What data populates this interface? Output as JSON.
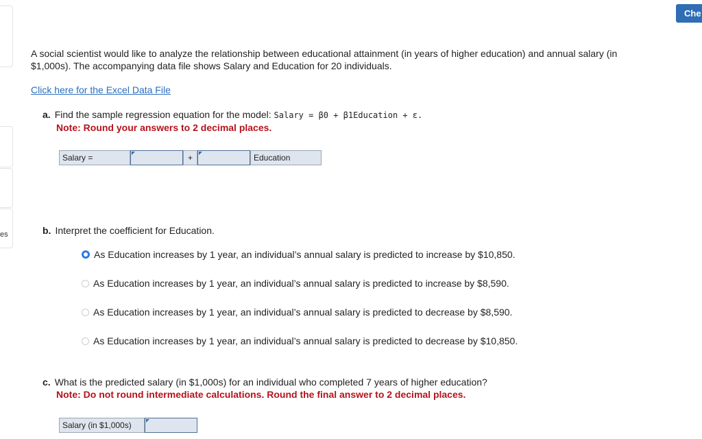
{
  "sidebar": {
    "partial_label": "es"
  },
  "header": {
    "check_button": "Che"
  },
  "intro": "A social scientist would like to analyze the relationship between educational attainment (in years of higher education) and annual salary (in $1,000s). The accompanying data file shows Salary and Education for 20 individuals.",
  "data_link": "Click here for the Excel Data File",
  "part_a": {
    "letter": "a.",
    "text": "Find the sample regression equation for the model: ",
    "model": "Salary = β0 + β1Education + ε.",
    "note": "Note: Round your answers to 2 decimal places.",
    "label_salary": "Salary =",
    "plus": "+",
    "label_education": "Education",
    "intercept_value": "",
    "slope_value": ""
  },
  "part_b": {
    "letter": "b.",
    "text": "Interpret the coefficient for Education.",
    "options": [
      {
        "label": "As Education increases by 1 year, an individual’s annual salary is predicted to increase by $10,850.",
        "selected": true
      },
      {
        "label": "As Education increases by 1 year, an individual’s annual salary is predicted to increase by $8,590.",
        "selected": false
      },
      {
        "label": "As Education increases by 1 year, an individual’s annual salary is predicted to decrease by $8,590.",
        "selected": false
      },
      {
        "label": "As Education increases by 1 year, an individual’s annual salary is predicted to decrease by $10,850.",
        "selected": false
      }
    ]
  },
  "part_c": {
    "letter": "c.",
    "text": "What is the predicted salary (in $1,000s) for an individual who completed 7 years of higher education?",
    "note": "Note: Do not round intermediate calculations. Round the final answer to 2 decimal places.",
    "label": "Salary (in $1,000s)",
    "value": ""
  },
  "colors": {
    "accent": "#2f6db5",
    "note": "#b5121b",
    "radio": "#2f7be0"
  }
}
